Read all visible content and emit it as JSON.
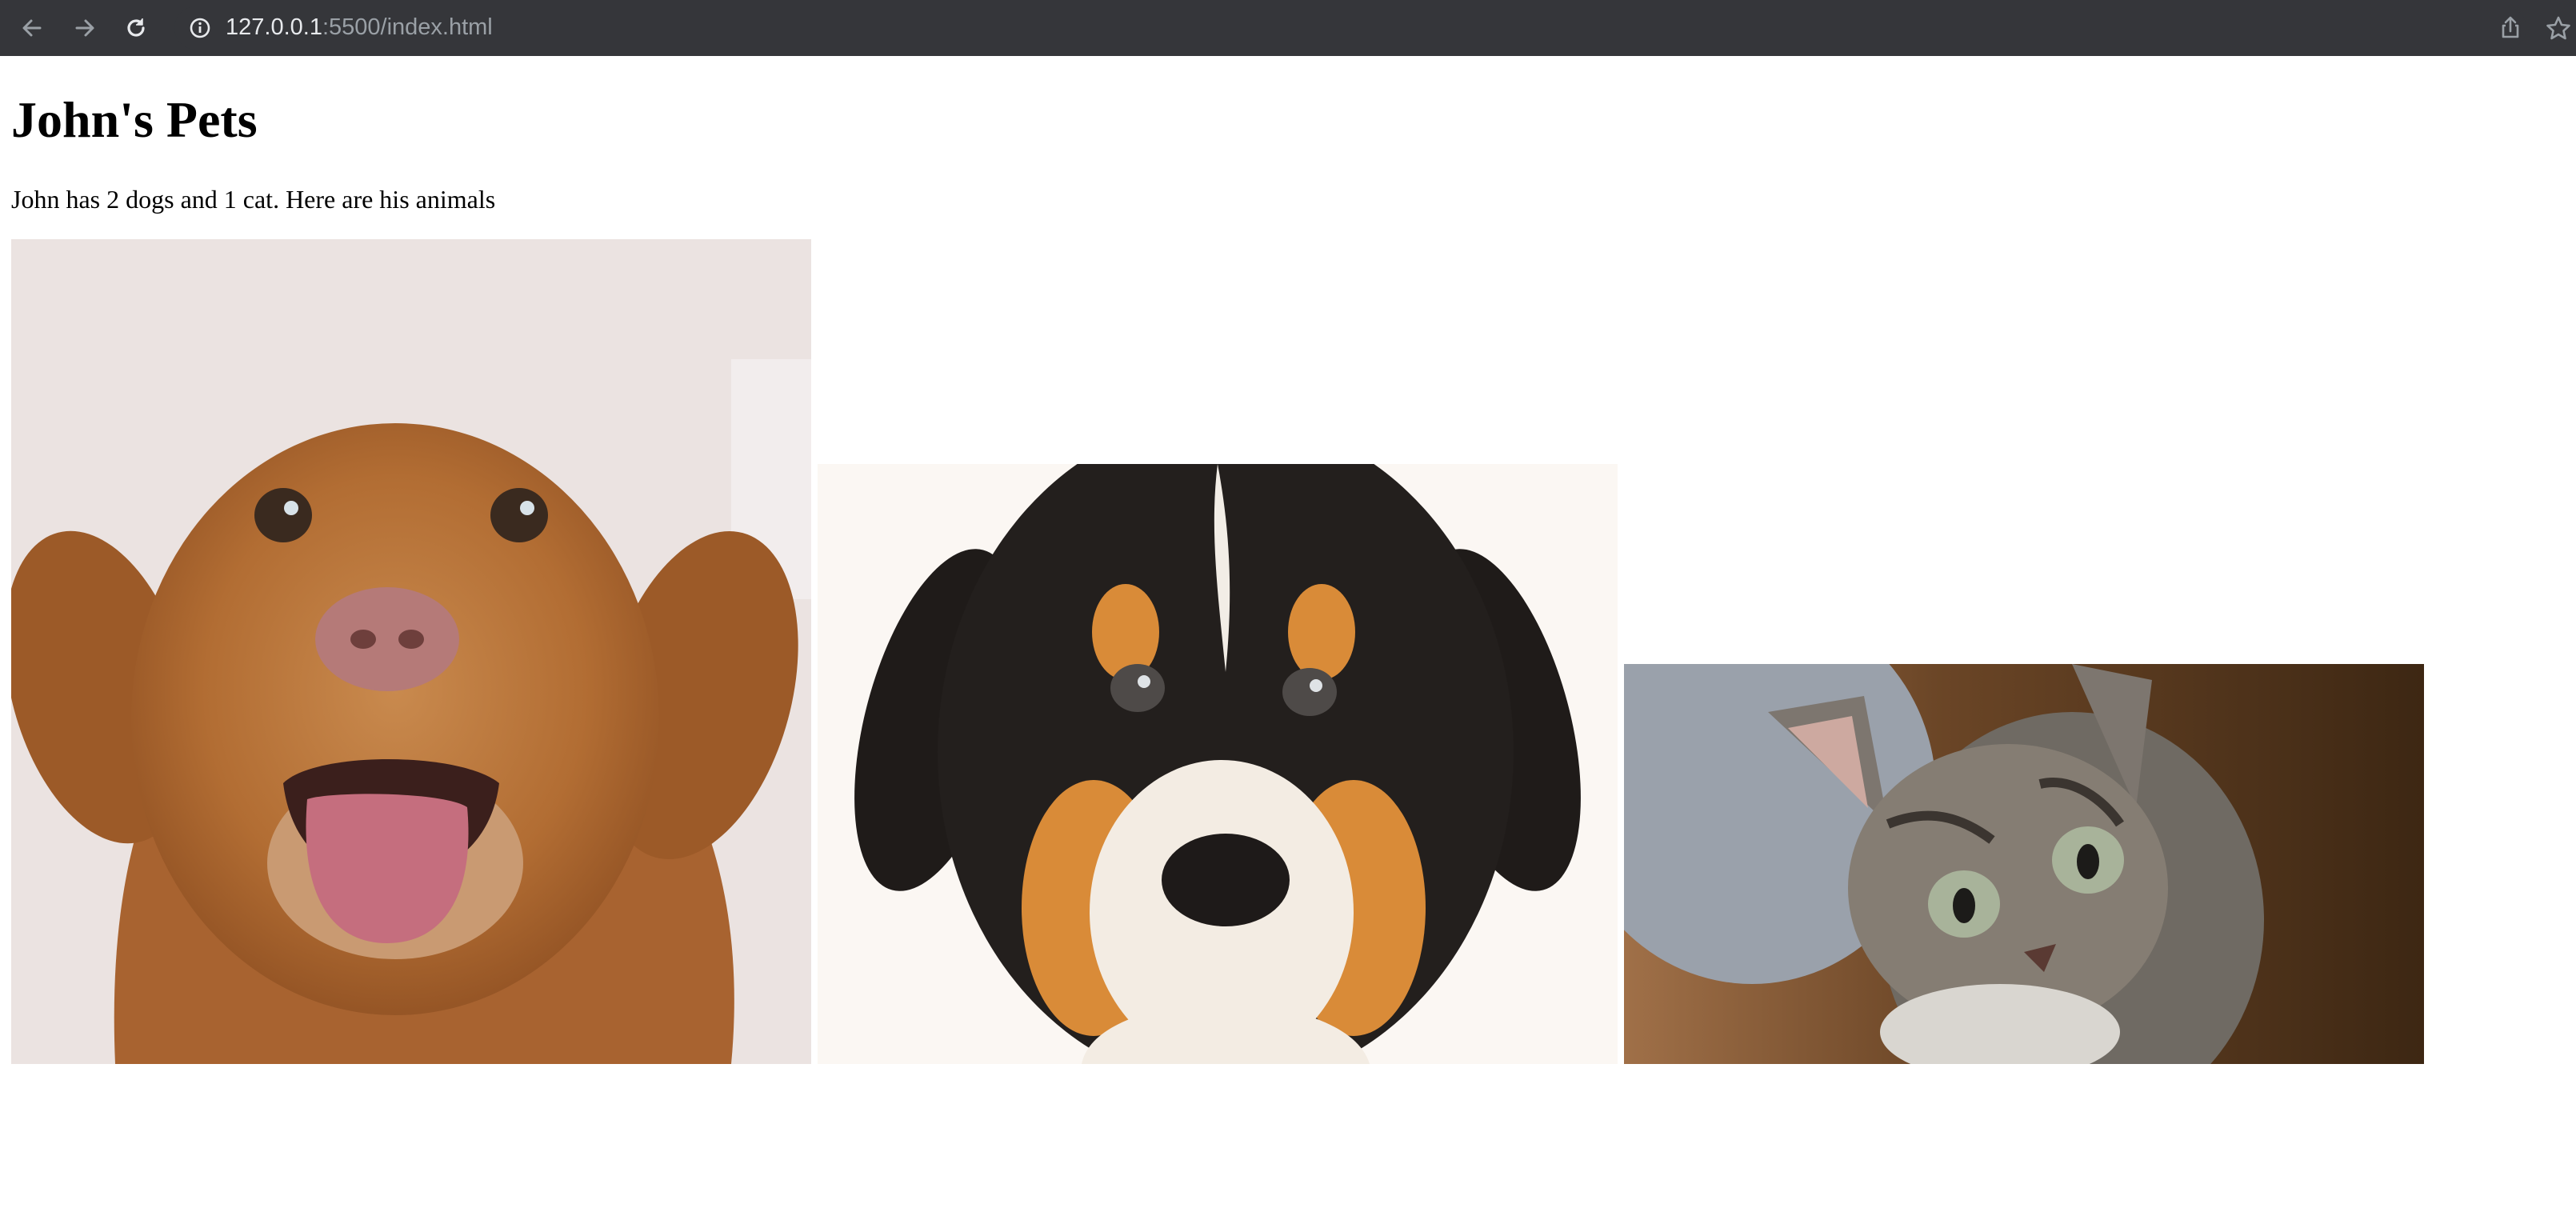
{
  "browser": {
    "url_host": "127.0.0.1",
    "url_path": ":5500/index.html",
    "icons": [
      "back-arrow-icon",
      "forward-arrow-icon",
      "reload-icon",
      "site-info-icon",
      "share-icon",
      "bookmark-star-icon"
    ]
  },
  "page": {
    "title": "John's Pets",
    "intro": "John has 2 dogs and 1 cat. Here are his animals"
  },
  "images": [
    {
      "subject": "dog"
    },
    {
      "subject": "dog"
    },
    {
      "subject": "cat"
    }
  ]
}
